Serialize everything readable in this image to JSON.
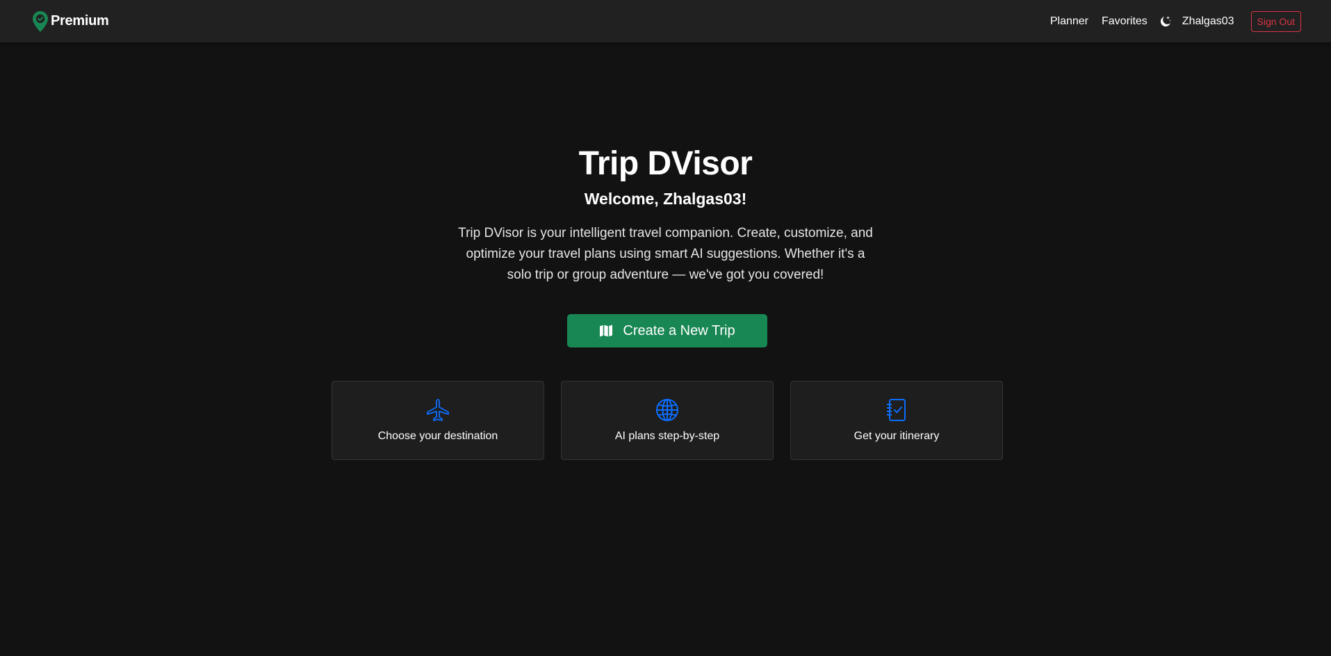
{
  "navbar": {
    "brand": "Premium",
    "brand_icon": "map-pin-check-icon",
    "links": [
      "Planner",
      "Favorites"
    ],
    "theme_toggle_icon": "moon-stars-icon",
    "username": "Zhalgas03",
    "sign_out": "Sign Out"
  },
  "hero": {
    "title": "Trip DVisor",
    "welcome": "Welcome, Zhalgas03!",
    "description": "Trip DVisor is your intelligent travel companion. Create, customize, and optimize your travel plans using smart AI suggestions. Whether it's a solo trip or group adventure — we've got you covered!",
    "cta_label": "Create a New Trip",
    "cta_icon": "map-icon"
  },
  "features": [
    {
      "label": "Choose your destination",
      "icon": "airplane-icon"
    },
    {
      "label": "AI plans step-by-step",
      "icon": "globe-icon"
    },
    {
      "label": "Get your itinerary",
      "icon": "journal-check-icon"
    }
  ],
  "colors": {
    "background": "#121212",
    "navbar": "#212121",
    "brand_accent": "#198754",
    "icon_accent": "#0d6efd",
    "danger": "#dc3545",
    "card": "#1e1e1e"
  }
}
